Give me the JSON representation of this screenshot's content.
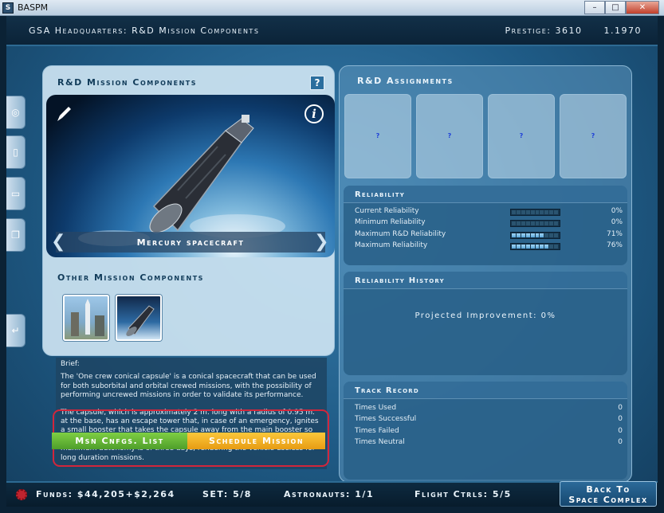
{
  "window": {
    "title": "BASPM",
    "app_icon": "S"
  },
  "header": {
    "title": "GSA Headquarters: R&D Mission Components",
    "prestige": "Prestige: 3610",
    "date": "1.1970"
  },
  "left_nav": {
    "icons": [
      "target-icon",
      "document-icon",
      "folder-icon",
      "copy-icon",
      "return-icon"
    ]
  },
  "components_panel": {
    "title": "R&D Mission Components",
    "help_label": "?",
    "current_component": "Mercury spacecraft",
    "info_label": "i",
    "other_title": "Other Mission Components"
  },
  "brief": {
    "heading": "Brief:",
    "paragraph1": "The 'One crew conical capsule' is a conical spacecraft that can be used for both suborbital and orbital crewed missions, with the possibility of performing uncrewed missions in order to validate its performance.",
    "paragraph2": "The capsule, which is approximately 2 m. long with a radius of 0.95 m. at the base, has an escape tower that, in case of an emergency, ignites a small booster that takes the capsule away from the main booster so that it can land safely by parachute. Due to its small volume, its maximum autonomy is of three days, rendering the vehicle useless for long duration missions."
  },
  "actions": {
    "msn_cnfgs_label": "Msn Cnfgs. List",
    "schedule_label": "Schedule Mission"
  },
  "assignments": {
    "title": "R&D Assignments",
    "slots": [
      "?",
      "?",
      "?",
      "?"
    ]
  },
  "reliability": {
    "title": "Reliability",
    "rows": [
      {
        "label": "Current Reliability",
        "value": "0%",
        "fill": 0
      },
      {
        "label": "Minimum Reliability",
        "value": "0%",
        "fill": 0
      },
      {
        "label": "Maximum R&D Reliability",
        "value": "71%",
        "fill": 0.71
      },
      {
        "label": "Maximum Reliability",
        "value": "76%",
        "fill": 0.76
      }
    ]
  },
  "reliability_history": {
    "title": "Reliability History",
    "projected": "Projected Improvement: 0%"
  },
  "track_record": {
    "title": "Track Record",
    "rows": [
      {
        "label": "Times Used",
        "value": "0"
      },
      {
        "label": "Times Successful",
        "value": "0"
      },
      {
        "label": "Times Failed",
        "value": "0"
      },
      {
        "label": "Times Neutral",
        "value": "0"
      }
    ]
  },
  "footer": {
    "funds": "Funds: $44,205+$2,264",
    "set": "SET: 5/8",
    "astronauts": "Astronauts: 1/1",
    "flight_ctrls": "Flight Ctrls: 5/5",
    "back_line1": "Back To",
    "back_line2": "Space Complex"
  }
}
